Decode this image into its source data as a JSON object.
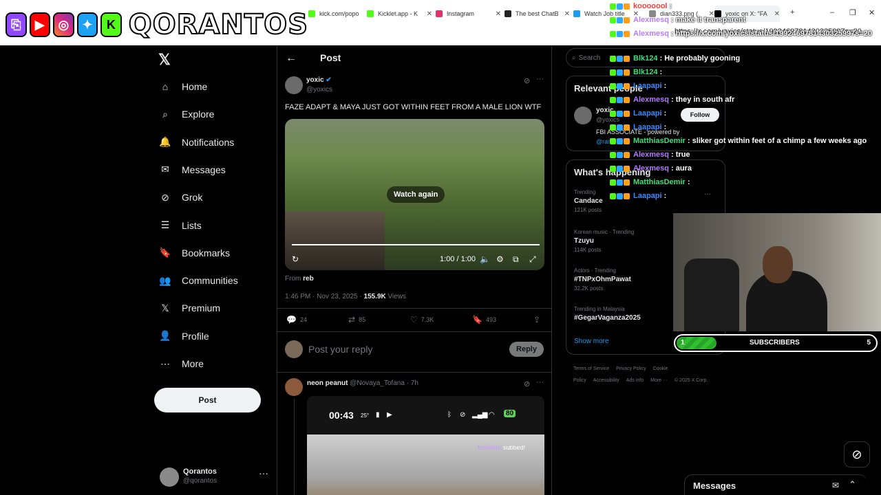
{
  "browser": {
    "tabs": [
      {
        "label": "kick.com/popo",
        "color": "#53fc18"
      },
      {
        "label": "Kicklet.app - K",
        "color": "#53fc18"
      },
      {
        "label": "Instagram",
        "color": "#e1306c"
      },
      {
        "label": "The best ChatB",
        "color": "#222222"
      },
      {
        "label": "Watch Job title",
        "color": "#1d9bf0"
      },
      {
        "label": "dian333.png (",
        "color": "#888888"
      },
      {
        "label": "yoxic on X: \"FA",
        "color": "#000000"
      }
    ],
    "address": "https://x.com/yoxics/status/1992469781430325997s=20"
  },
  "overlay": {
    "brand": "QORANTOS"
  },
  "nav": {
    "items": [
      {
        "label": "Home",
        "icon": "home-icon"
      },
      {
        "label": "Explore",
        "icon": "search-icon"
      },
      {
        "label": "Notifications",
        "icon": "bell-icon"
      },
      {
        "label": "Messages",
        "icon": "mail-icon"
      },
      {
        "label": "Grok",
        "icon": "grok-icon"
      },
      {
        "label": "Lists",
        "icon": "list-icon"
      },
      {
        "label": "Bookmarks",
        "icon": "bookmark-icon"
      },
      {
        "label": "Communities",
        "icon": "people-icon"
      },
      {
        "label": "Premium",
        "icon": "x-icon"
      },
      {
        "label": "Profile",
        "icon": "person-icon"
      },
      {
        "label": "More",
        "icon": "more-circle-icon"
      }
    ],
    "post_label": "Post",
    "account": {
      "name": "Qorantos",
      "handle": "@qorantos"
    }
  },
  "post": {
    "header": "Post",
    "author": {
      "name": "yoxic",
      "handle": "@yoxics"
    },
    "text": "FAZE ADAPT & MAYA JUST GOT WITHIN FEET FROM A MALE LION WTF",
    "video": {
      "overlay": "Watch again",
      "time": "1:00 / 1:00",
      "progress": 1.0
    },
    "from_prefix": "From",
    "from_source": "reb",
    "timestamp": "1:46 PM · Nov 23, 2025 · ",
    "views": "155.9K",
    "views_label": "Views",
    "stats": {
      "replies": "24",
      "reposts": "85",
      "likes": "7.3K",
      "bookmarks": "493"
    },
    "reply_placeholder": "Post your reply",
    "reply_label": "Reply"
  },
  "reply": {
    "name": "neon peanut",
    "handle": "@Novaya_Tofana · 7h",
    "phone_time": "00:43",
    "phone_temp": "25°",
    "battery": "80",
    "subbed_user": "fushiferu",
    "subbed_text": "subbed!"
  },
  "right": {
    "search_placeholder": "Search",
    "relevant_title": "Relevant people",
    "relevant": {
      "name": "yoxic",
      "handle": "@yoxics",
      "bio": "FBI ASSOCIATE - powered by",
      "mention": "@rai",
      "follow": "Follow"
    },
    "happening_title": "What's happening",
    "trends": [
      {
        "context": "Trending",
        "name": "Candace",
        "count": "121K posts"
      },
      {
        "context": "Korean music · Trending",
        "name": "Tzuyu",
        "count": "114K posts"
      },
      {
        "context": "Actors · Trending",
        "name": "#TNPxOhmPawat",
        "count": "32.2K posts"
      },
      {
        "context": "Trending in Malaysia",
        "name": "#GegarVaganza2025",
        "count": ""
      }
    ],
    "show_more": "Show more",
    "footer": [
      "Terms of Service",
      "Privacy Policy",
      "Cookie Policy",
      "Accessibility",
      "Ads info",
      "More ···",
      "© 2025 X Corp."
    ]
  },
  "chat": [
    {
      "user": "kooooool",
      "text": "",
      "color": "#ff3b3b"
    },
    {
      "user": "Alexmesq",
      "text": "make it transparent",
      "color": "#b57cff"
    },
    {
      "user": "Alexmesq",
      "text": "https://x.com/yoxics/status/1992469781430325997s=20",
      "color": "#b57cff"
    },
    {
      "user": "Blk124",
      "text": "He probably gooning",
      "color": "#3adf7a"
    },
    {
      "user": "Blk124",
      "text": "",
      "color": "#3adf7a"
    },
    {
      "user": "Laapapi",
      "text": "",
      "color": "#3b8bff"
    },
    {
      "user": "Alexmesq",
      "text": "they in south afr",
      "color": "#b57cff"
    },
    {
      "user": "Laapapi",
      "text": "",
      "color": "#3b8bff"
    },
    {
      "user": "Laapapi",
      "text": "",
      "color": "#3b8bff"
    },
    {
      "user": "MatthiasDemir",
      "text": "sliker got within feet of a chimp a few weeks ago",
      "color": "#3adf7a"
    },
    {
      "user": "Alexmesq",
      "text": "true",
      "color": "#b57cff"
    },
    {
      "user": "Alexmesq",
      "text": "aura",
      "color": "#b57cff"
    },
    {
      "user": "MatthiasDemir",
      "text": "",
      "color": "#3adf7a"
    },
    {
      "user": "Laapapi",
      "text": "",
      "color": "#3b8bff"
    }
  ],
  "subs": {
    "start": "1",
    "label": "SUBSCRIBERS",
    "goal": "5",
    "progress": 0.2
  },
  "dock": {
    "messages_title": "Messages"
  }
}
